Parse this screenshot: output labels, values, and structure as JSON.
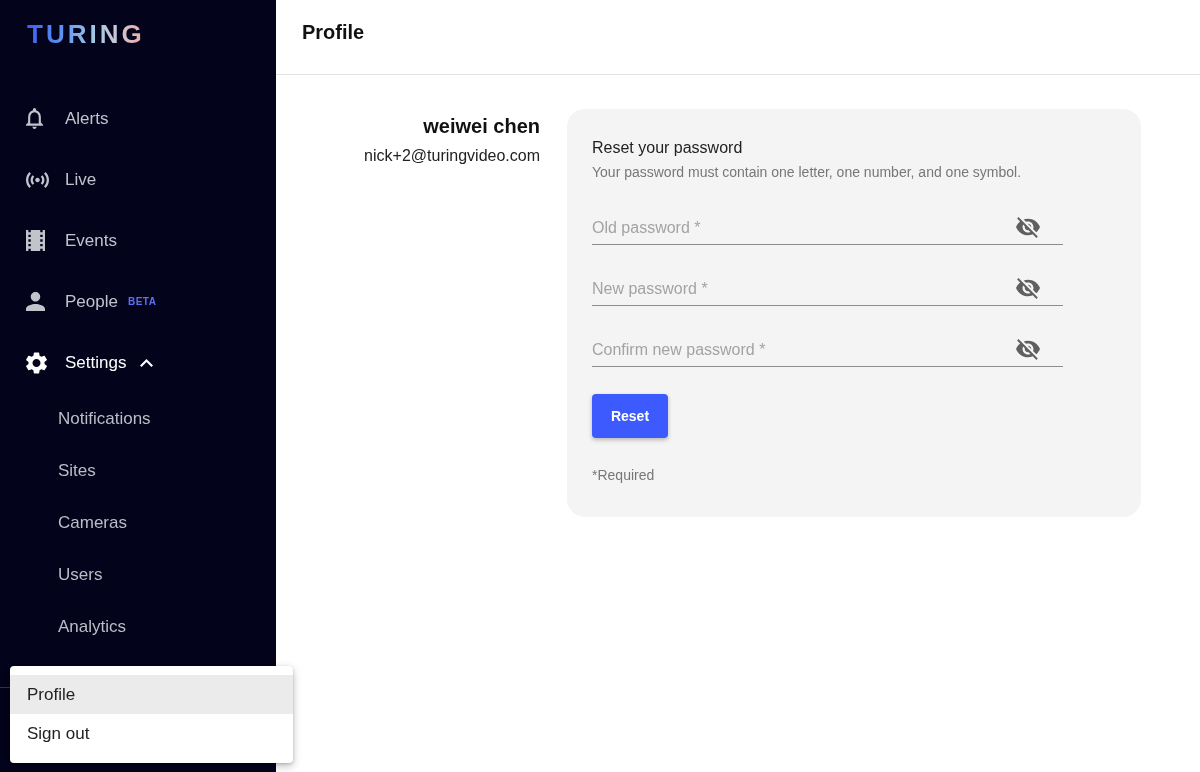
{
  "sidebar": {
    "logo": "TURING",
    "items": [
      {
        "label": "Alerts",
        "expanded": false
      },
      {
        "label": "Live",
        "expanded": false
      },
      {
        "label": "Events",
        "expanded": false
      },
      {
        "label": "People",
        "badge": "BETA",
        "expanded": false
      },
      {
        "label": "Settings",
        "expanded": true,
        "children": [
          {
            "label": "Notifications"
          },
          {
            "label": "Sites"
          },
          {
            "label": "Cameras"
          },
          {
            "label": "Users"
          },
          {
            "label": "Analytics"
          }
        ]
      }
    ]
  },
  "account_menu": {
    "items": [
      {
        "label": "Profile",
        "selected": true
      },
      {
        "label": "Sign out",
        "selected": false
      }
    ]
  },
  "header": {
    "title": "Profile"
  },
  "profile": {
    "name": "weiwei chen",
    "email": "nick+2@turingvideo.com"
  },
  "password_card": {
    "title": "Reset your password",
    "hint": "Your password must contain one letter, one number, and one symbol.",
    "fields": [
      {
        "placeholder": "Old password *",
        "revealed": false
      },
      {
        "placeholder": "New password *",
        "revealed": false
      },
      {
        "placeholder": "Confirm new password *",
        "revealed": false
      }
    ],
    "button": "Reset",
    "note": "*Required"
  }
}
